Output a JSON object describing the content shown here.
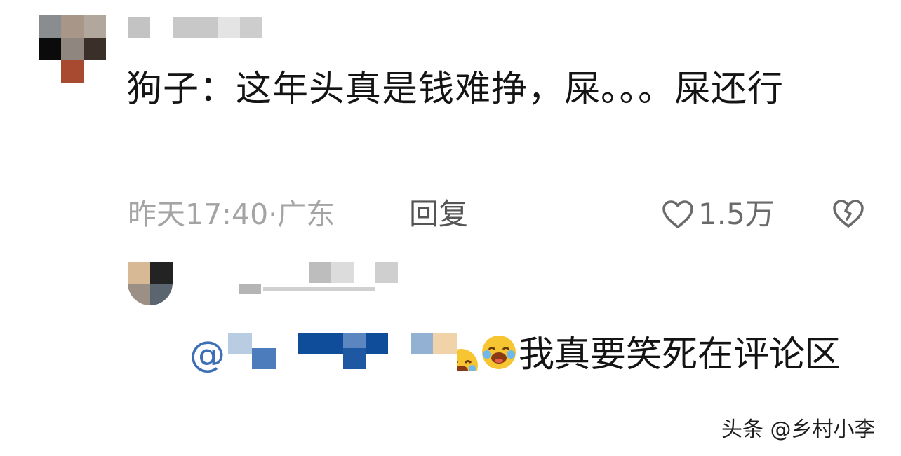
{
  "comment": {
    "text": "狗子：这年头真是钱难挣，屎。。。屎还行",
    "time_location": "昨天17:40·广东",
    "reply_label": "回复",
    "like_count": "1.5万",
    "icons": {
      "like": "heart-outline-icon",
      "dislike": "broken-heart-icon"
    }
  },
  "reply": {
    "mention_prefix": "@",
    "text_line": "我真要笑死在评论区",
    "emoji": "laugh-cry-emoji"
  },
  "watermark": "头条 @乡村小李",
  "colors": {
    "accent": "#3c6fb5",
    "muted": "#a4a4a4"
  }
}
